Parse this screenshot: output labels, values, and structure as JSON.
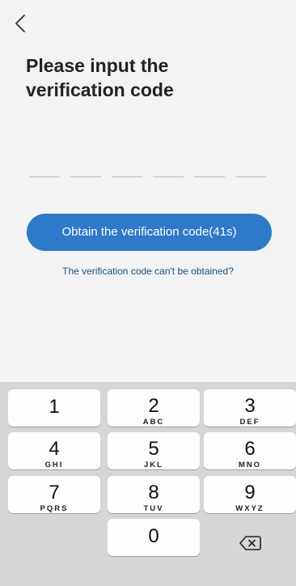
{
  "header": {
    "back_icon": "chevron-left-icon",
    "title": "Please input the\nverification code"
  },
  "code_input": {
    "slot_count": 6
  },
  "actions": {
    "obtain_label": "Obtain the verification code(41s)",
    "help_link": "The verification code can't be obtained?"
  },
  "keypad": {
    "keys": [
      {
        "num": "1",
        "letters": ""
      },
      {
        "num": "2",
        "letters": "ABC"
      },
      {
        "num": "3",
        "letters": "DEF"
      },
      {
        "num": "4",
        "letters": "GHI"
      },
      {
        "num": "5",
        "letters": "JKL"
      },
      {
        "num": "6",
        "letters": "MNO"
      },
      {
        "num": "7",
        "letters": "PQRS"
      },
      {
        "num": "8",
        "letters": "TUV"
      },
      {
        "num": "9",
        "letters": "WXYZ"
      },
      {
        "num": "0",
        "letters": ""
      }
    ],
    "delete_icon": "backspace-icon"
  },
  "colors": {
    "accent": "#2f79c9",
    "link": "#1f4f7a",
    "keypad_bg": "#d6d6d9"
  }
}
